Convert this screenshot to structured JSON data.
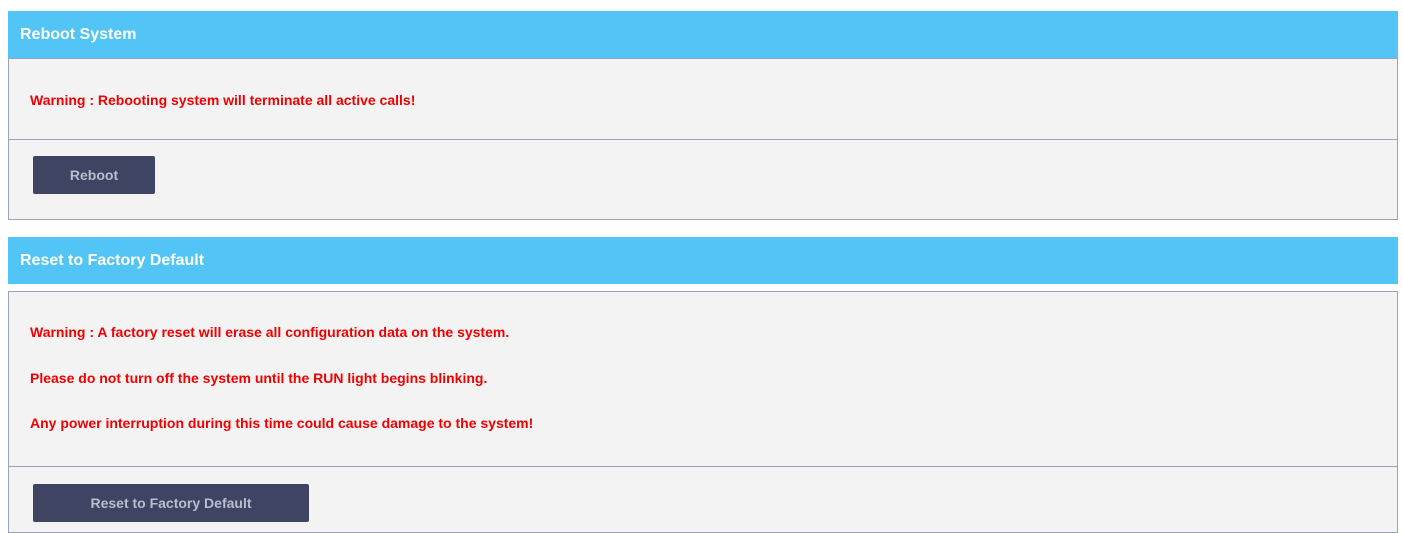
{
  "reboot": {
    "title": "Reboot System",
    "warning": "Warning : Rebooting system will terminate all active calls!",
    "button_label": "Reboot"
  },
  "factory_reset": {
    "title": "Reset to Factory Default",
    "warnings": [
      "Warning : A factory reset will erase all configuration data on the system.",
      "Please do not turn off the system until the RUN light begins blinking.",
      "Any power interruption during this time could cause damage to the system!"
    ],
    "button_label": "Reset to Factory Default"
  },
  "colors": {
    "header_bg": "#52c5f6",
    "header_text": "#ffffff",
    "warning_text": "#f00000",
    "button_bg": "#3e4462",
    "button_text": "#b9bdcd",
    "panel_bg": "#f3f3f3",
    "border": "#9aa3b8"
  }
}
